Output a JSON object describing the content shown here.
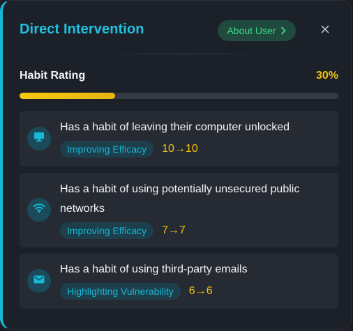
{
  "header": {
    "title": "Direct Intervention",
    "about_label": "About User",
    "close_icon": "close-icon",
    "chevron_icon": "chevron-right-icon"
  },
  "habit_rating": {
    "label": "Habit Rating",
    "value_text": "30%",
    "progress_fraction": 0.3
  },
  "habits": [
    {
      "icon": "monitor-icon",
      "text": "Has a habit of leaving their computer unlocked",
      "tag": "Improving Efficacy",
      "score": "10→10"
    },
    {
      "icon": "wifi-icon",
      "text": "Has a habit of using potentially unsecured public networks",
      "tag": "Improving Efficacy",
      "score": "7→7"
    },
    {
      "icon": "mail-icon",
      "text": "Has a habit of using third-party emails",
      "tag": "Highlighting Vulnerability",
      "score": "6→6"
    }
  ],
  "colors": {
    "accent": "#22c0e0",
    "progress": "#f6c90e",
    "about_bg": "#1f4a3d",
    "about_text": "#3ddc8a",
    "card_bg": "#262a33",
    "panel_bg": "#1c2028"
  }
}
